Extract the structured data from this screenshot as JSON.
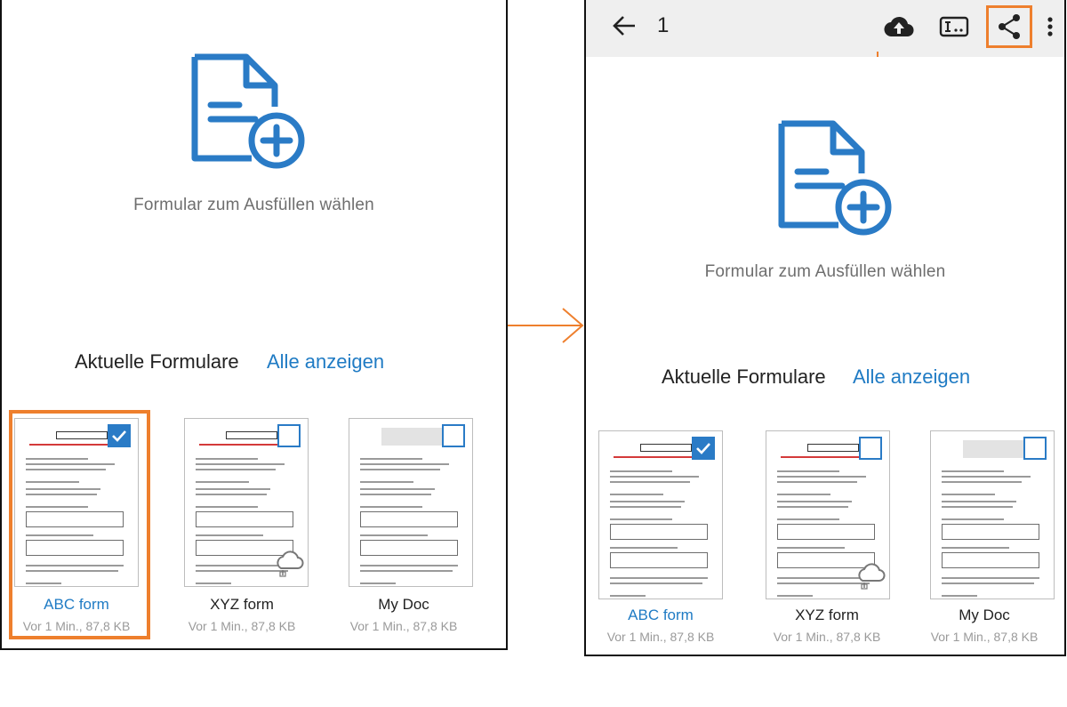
{
  "accent_color": "#ee7f2d",
  "link_color": "#1f7bc4",
  "icons": {
    "hero": "document-add-icon",
    "checkbox": "checkbox-icon",
    "cloud": "cloud-icon",
    "back": "arrow-left-icon",
    "upload": "cloud-upload-icon",
    "text": "text-field-icon",
    "share": "share-icon",
    "more": "more-vert-icon"
  },
  "left": {
    "prompt": "Formular zum Ausfüllen wählen",
    "section_title": "Aktuelle Formulare",
    "show_all": "Alle anzeigen",
    "forms": [
      {
        "name": "ABC form",
        "meta": "Vor 1 Min., 87,8 KB",
        "checked": true,
        "cloud": false,
        "template": "sample"
      },
      {
        "name": "XYZ form",
        "meta": "Vor 1 Min., 87,8 KB",
        "checked": false,
        "cloud": true,
        "template": "sample"
      },
      {
        "name": "My Doc",
        "meta": "Vor 1 Min., 87,8 KB",
        "checked": false,
        "cloud": false,
        "template": "form"
      }
    ]
  },
  "right": {
    "toolbar": {
      "selected_count": "1"
    },
    "prompt": "Formular zum Ausfüllen wählen",
    "section_title": "Aktuelle Formulare",
    "show_all": "Alle anzeigen",
    "forms": [
      {
        "name": "ABC form",
        "meta": "Vor 1 Min., 87,8 KB",
        "checked": true,
        "cloud": false,
        "template": "sample"
      },
      {
        "name": "XYZ form",
        "meta": "Vor 1 Min., 87,8 KB",
        "checked": false,
        "cloud": true,
        "template": "sample"
      },
      {
        "name": "My Doc",
        "meta": "Vor 1 Min., 87,8 KB",
        "checked": false,
        "cloud": false,
        "template": "form"
      }
    ]
  }
}
